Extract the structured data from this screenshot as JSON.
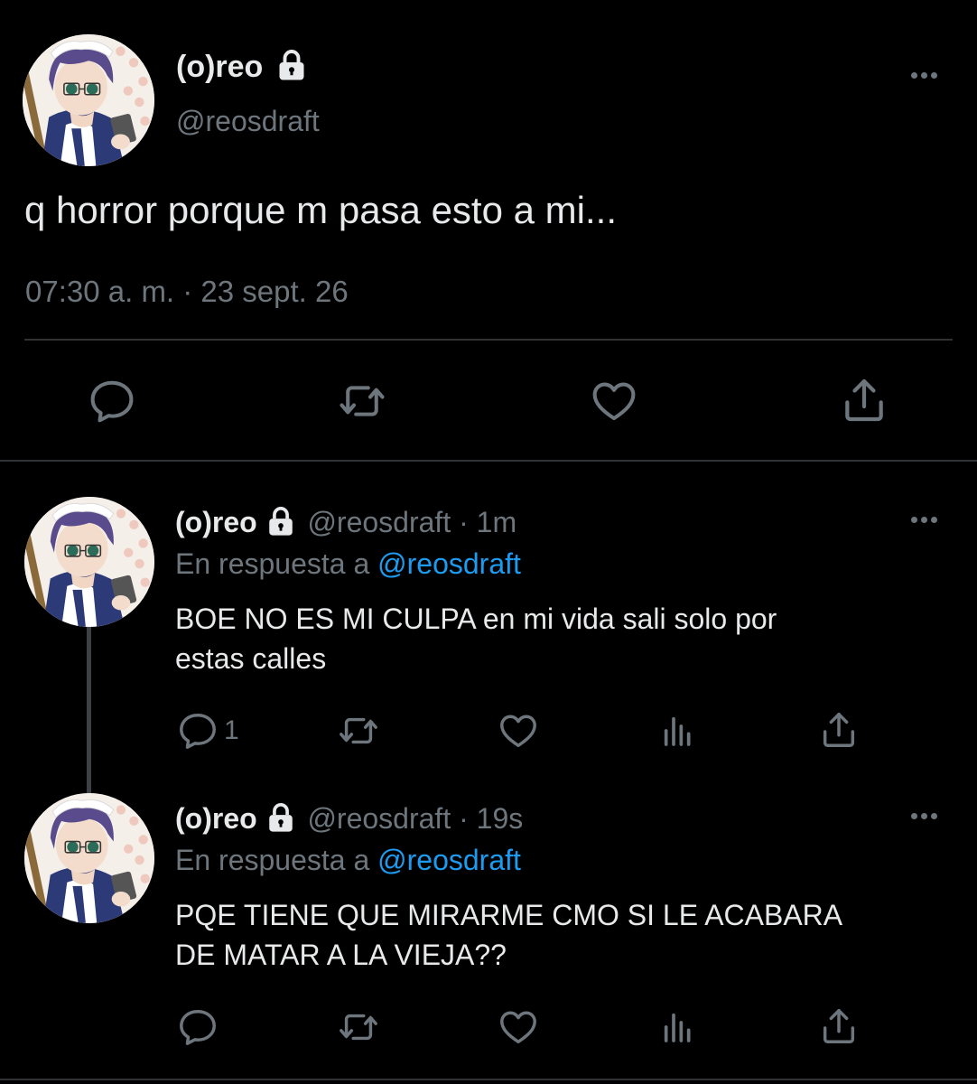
{
  "main_tweet": {
    "display_name": "(o)reo",
    "handle": "@reosdraft",
    "text": "q horror porque m pasa esto a mi...",
    "timestamp": "07:30 a. m. · 23 sept. 26",
    "actions": [
      "reply-icon",
      "retweet-icon",
      "like-icon",
      "share-icon"
    ]
  },
  "replies": [
    {
      "display_name": "(o)reo",
      "handle_time": "@reosdraft · 1m",
      "reply_prefix": "En respuesta a",
      "reply_to": "@reosdraft",
      "text_line1": "BOE NO ES MI CULPA en mi vida sali solo por",
      "text_line2": "estas calles",
      "reply_count": "1"
    },
    {
      "display_name": "(o)reo",
      "handle_time": "@reosdraft · 19s",
      "reply_prefix": "En respuesta a",
      "reply_to": "@reosdraft",
      "text_line1": "PQE TIENE QUE MIRARME CMO SI LE ACABARA",
      "text_line2": "DE MATAR A LA VIEJA??",
      "reply_count": ""
    }
  ],
  "colors": {
    "background": "#000000",
    "text": "#e7e9ea",
    "muted": "#6e767d",
    "link": "#1d9bf0",
    "divider": "#2f3336"
  }
}
